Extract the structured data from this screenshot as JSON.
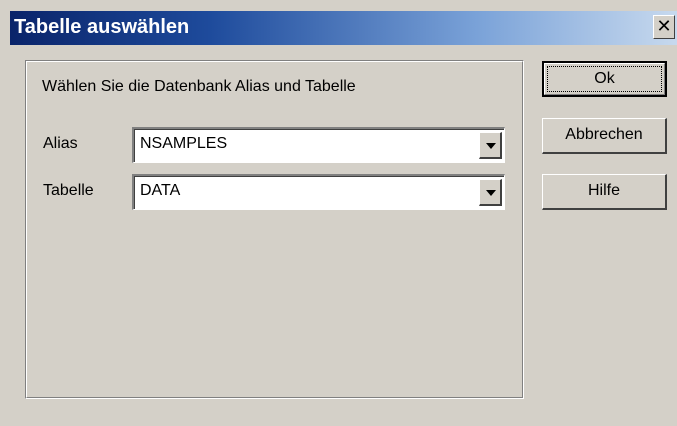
{
  "window": {
    "title": "Tabelle auswählen",
    "close_glyph": "✕"
  },
  "form": {
    "instruction": "Wählen Sie die Datenbank Alias und Tabelle",
    "alias_label": "Alias",
    "alias_value": "NSAMPLES",
    "table_label": "Tabelle",
    "table_value": "DATA"
  },
  "buttons": {
    "ok": "Ok",
    "cancel": "Abbrechen",
    "help": "Hilfe"
  },
  "icons": {
    "close": "close-icon",
    "dropdown": "chevron-down-icon"
  },
  "colors": {
    "titlebar_start": "#0a246a",
    "titlebar_end": "#c7d9ee",
    "face": "#d4d0c8"
  }
}
